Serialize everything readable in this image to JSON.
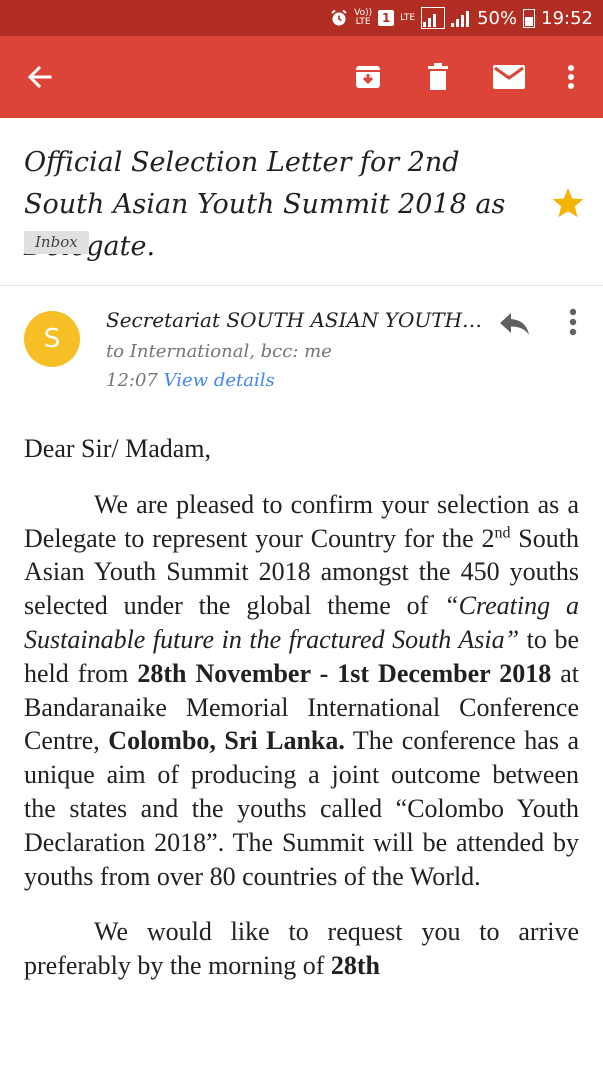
{
  "status_bar": {
    "volte": "Vo)) LTE",
    "sim": "1",
    "lte": "LTE",
    "battery_percent": "50%",
    "time": "19:52"
  },
  "toolbar": {
    "back_icon": "arrow-back-icon",
    "archive_icon": "archive-icon",
    "delete_icon": "trash-icon",
    "mark_unread_icon": "mail-icon",
    "more_icon": "more-vertical-icon"
  },
  "email": {
    "subject": "Official Selection Letter for 2nd South Asian Youth Summit 2018 as Delegate.",
    "label": "Inbox",
    "starred": true,
    "sender_initial": "S",
    "sender": "Secretariat SOUTH ASIAN YOUTH SUMMIT",
    "recipients": "to International, bcc: me",
    "time": "12:07",
    "view_details": "View details"
  },
  "body": {
    "greeting": "Dear Sir/ Madam,",
    "p1_a": "We are pleased to confirm your selection as a Delegate to represent your Country for the 2",
    "p1_sup": "nd",
    "p1_b": " South Asian Youth Summit 2018 amongst the 450 youths selected under the global theme of ",
    "p1_theme": "“Creating a Sustainable future in the fractured South Asia”",
    "p1_c": " to be held from ",
    "p1_dates": "28th November - 1st December 2018",
    "p1_d": " at Bandaranaike Memorial International Conference Centre, ",
    "p1_place": "Colombo, Sri Lanka.",
    "p1_e": " The conference has a unique aim of producing a joint outcome between the states and the youths called “Colombo Youth Declaration 2018”. The Summit will be attended by youths from over 80 countries of the World.",
    "p2_a": "We would like to request you to arrive preferably by the morning of ",
    "p2_b": "28th"
  },
  "colors": {
    "status_bar": "#b32e22",
    "app_bar": "#db4437",
    "avatar": "#f6bf26",
    "star": "#f4b400",
    "link": "#4285f4"
  }
}
